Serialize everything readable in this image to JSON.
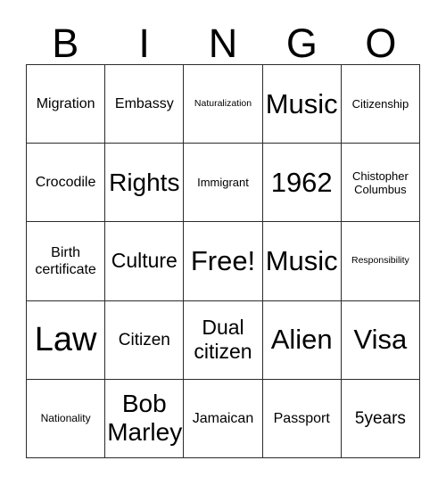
{
  "card": {
    "title": "BINGO",
    "columns": 5,
    "rows": 5,
    "border_color": "#2b2b2b",
    "background_color": "#ffffff",
    "text_color": "#000000"
  },
  "header": {
    "letters": [
      "B",
      "I",
      "N",
      "G",
      "O"
    ]
  },
  "grid": {
    "cells": [
      {
        "text": "Migration",
        "size": "md",
        "row": 1,
        "col": 1
      },
      {
        "text": "Embassy",
        "size": "md",
        "row": 1,
        "col": 2
      },
      {
        "text": "Naturalization",
        "size": "xxs",
        "row": 1,
        "col": 3
      },
      {
        "text": "Music",
        "size": "3xl",
        "row": 1,
        "col": 4
      },
      {
        "text": "Citizenship",
        "size": "sm",
        "row": 1,
        "col": 5
      },
      {
        "text": "Crocodile",
        "size": "md",
        "row": 2,
        "col": 1
      },
      {
        "text": "Rights",
        "size": "xxl",
        "row": 2,
        "col": 2
      },
      {
        "text": "Immigrant",
        "size": "sm",
        "row": 2,
        "col": 3
      },
      {
        "text": "1962",
        "size": "3xl",
        "row": 2,
        "col": 4
      },
      {
        "text": "Chistopher\nColumbus",
        "size": "sm",
        "row": 2,
        "col": 5
      },
      {
        "text": "Birth\ncertificate",
        "size": "md",
        "row": 3,
        "col": 1
      },
      {
        "text": "Culture",
        "size": "xl",
        "row": 3,
        "col": 2
      },
      {
        "text": "Free!",
        "size": "3xl",
        "row": 3,
        "col": 3
      },
      {
        "text": "Music",
        "size": "3xl",
        "row": 3,
        "col": 4
      },
      {
        "text": "Responsibility",
        "size": "xxs",
        "row": 3,
        "col": 5
      },
      {
        "text": "Law",
        "size": "4xl",
        "row": 4,
        "col": 1
      },
      {
        "text": "Citizen",
        "size": "lg",
        "row": 4,
        "col": 2
      },
      {
        "text": "Dual\ncitizen",
        "size": "xl",
        "row": 4,
        "col": 3
      },
      {
        "text": "Alien",
        "size": "3xl",
        "row": 4,
        "col": 4
      },
      {
        "text": "Visa",
        "size": "3xl",
        "row": 4,
        "col": 5
      },
      {
        "text": "Nationality",
        "size": "xs",
        "row": 5,
        "col": 1
      },
      {
        "text": "Bob\nMarley",
        "size": "xxl",
        "row": 5,
        "col": 2
      },
      {
        "text": "Jamaican",
        "size": "md",
        "row": 5,
        "col": 3
      },
      {
        "text": "Passport",
        "size": "md",
        "row": 5,
        "col": 4
      },
      {
        "text": "5years",
        "size": "lg",
        "row": 5,
        "col": 5
      }
    ]
  }
}
